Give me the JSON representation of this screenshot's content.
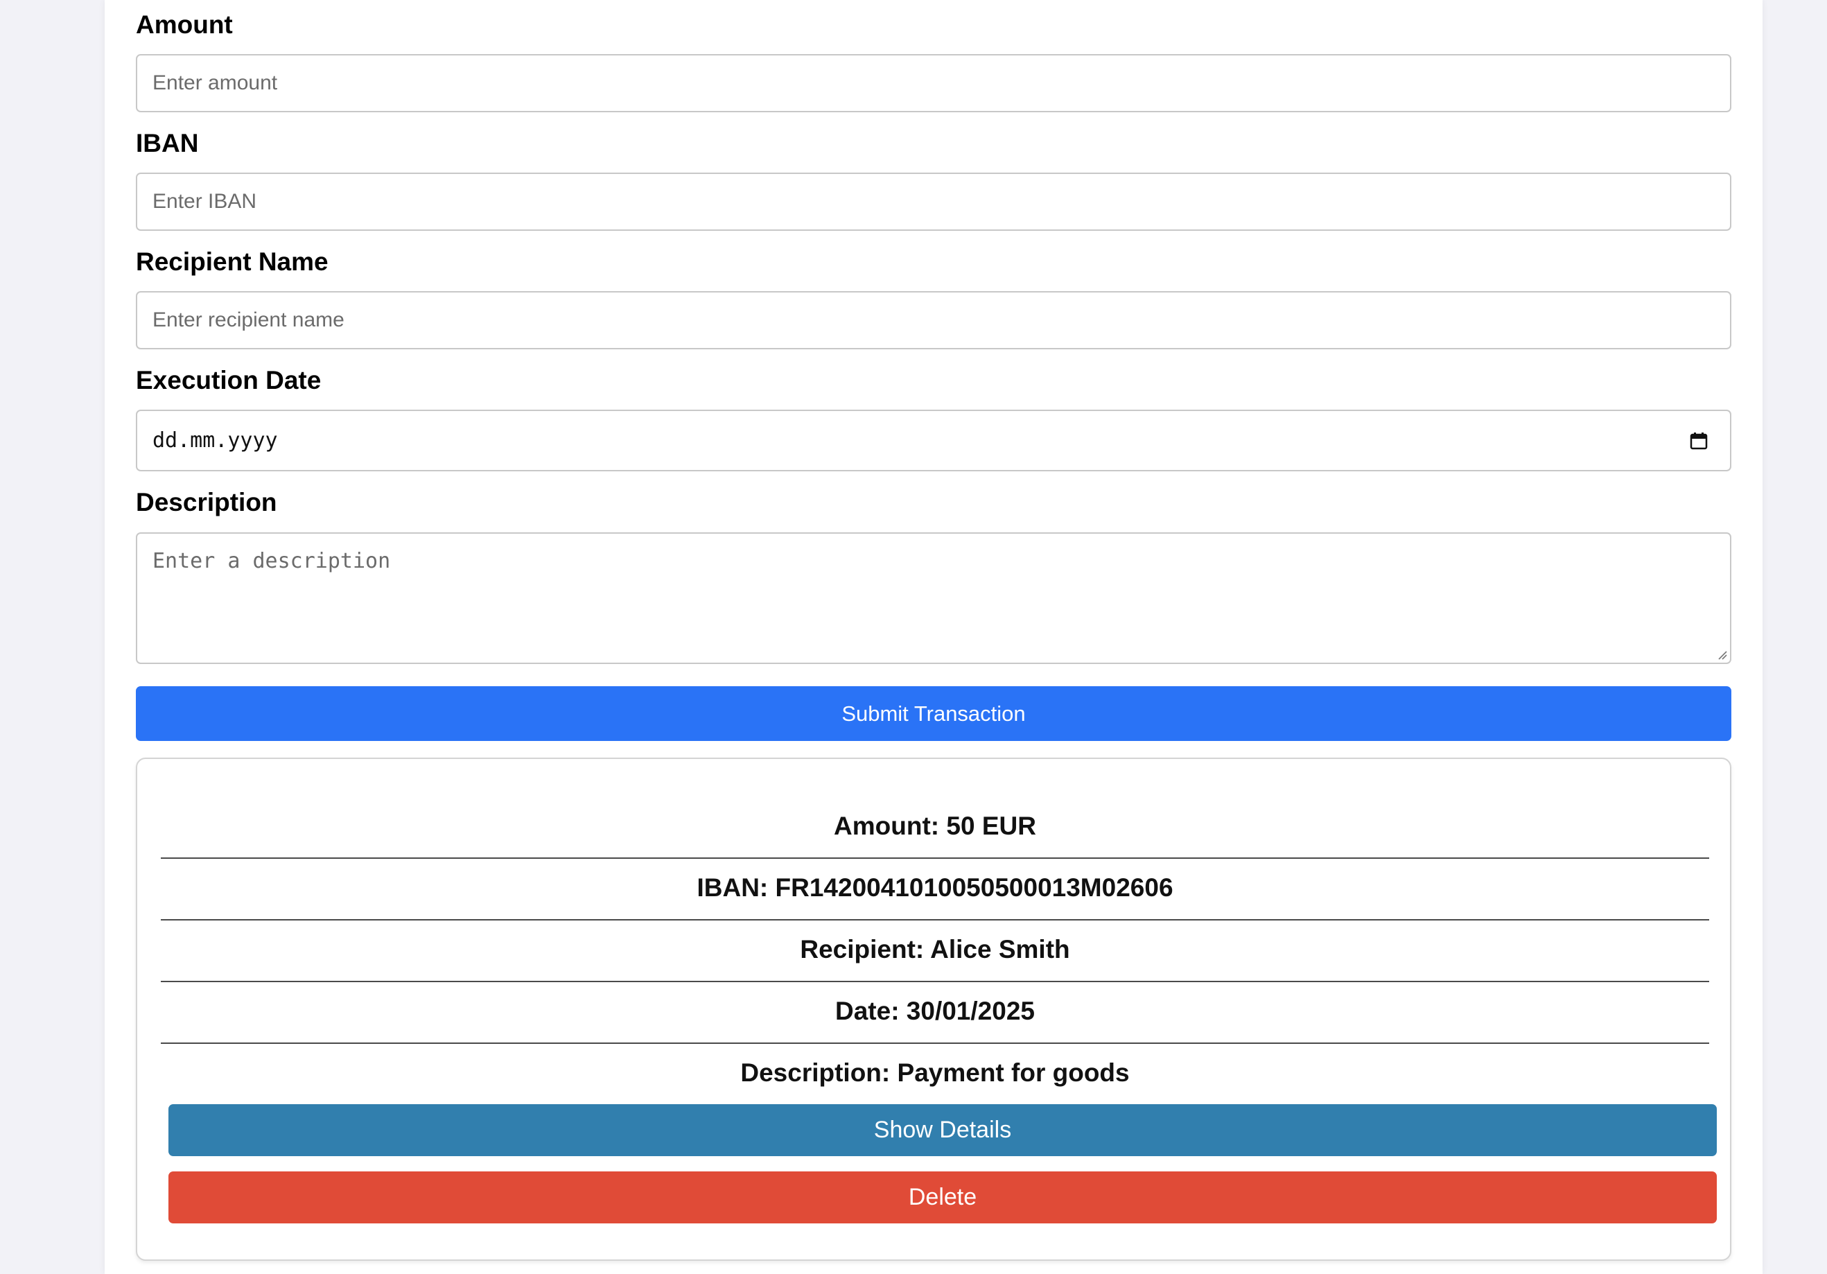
{
  "form": {
    "amount": {
      "label": "Amount",
      "placeholder": "Enter amount"
    },
    "iban": {
      "label": "IBAN",
      "placeholder": "Enter IBAN"
    },
    "recipient": {
      "label": "Recipient Name",
      "placeholder": "Enter recipient name"
    },
    "execution_date": {
      "label": "Execution Date",
      "placeholder": "dd.mm.yyyy"
    },
    "description": {
      "label": "Description",
      "placeholder": "Enter a description"
    },
    "submit_label": "Submit Transaction"
  },
  "transaction": {
    "amount": "Amount: 50 EUR",
    "iban": "IBAN: FR1420041010050500013M02606",
    "recipient": "Recipient: Alice Smith",
    "date": "Date: 30/01/2025",
    "description": "Description: Payment for goods",
    "show_details_label": "Show Details",
    "delete_label": "Delete"
  },
  "colors": {
    "submit": "#2a73f6",
    "show_details": "#317fae",
    "delete": "#e04b37",
    "page_background": "#f2f2f7"
  },
  "icons": {
    "date_picker": "calendar-icon",
    "textarea_resize": "resize-handle-icon"
  }
}
